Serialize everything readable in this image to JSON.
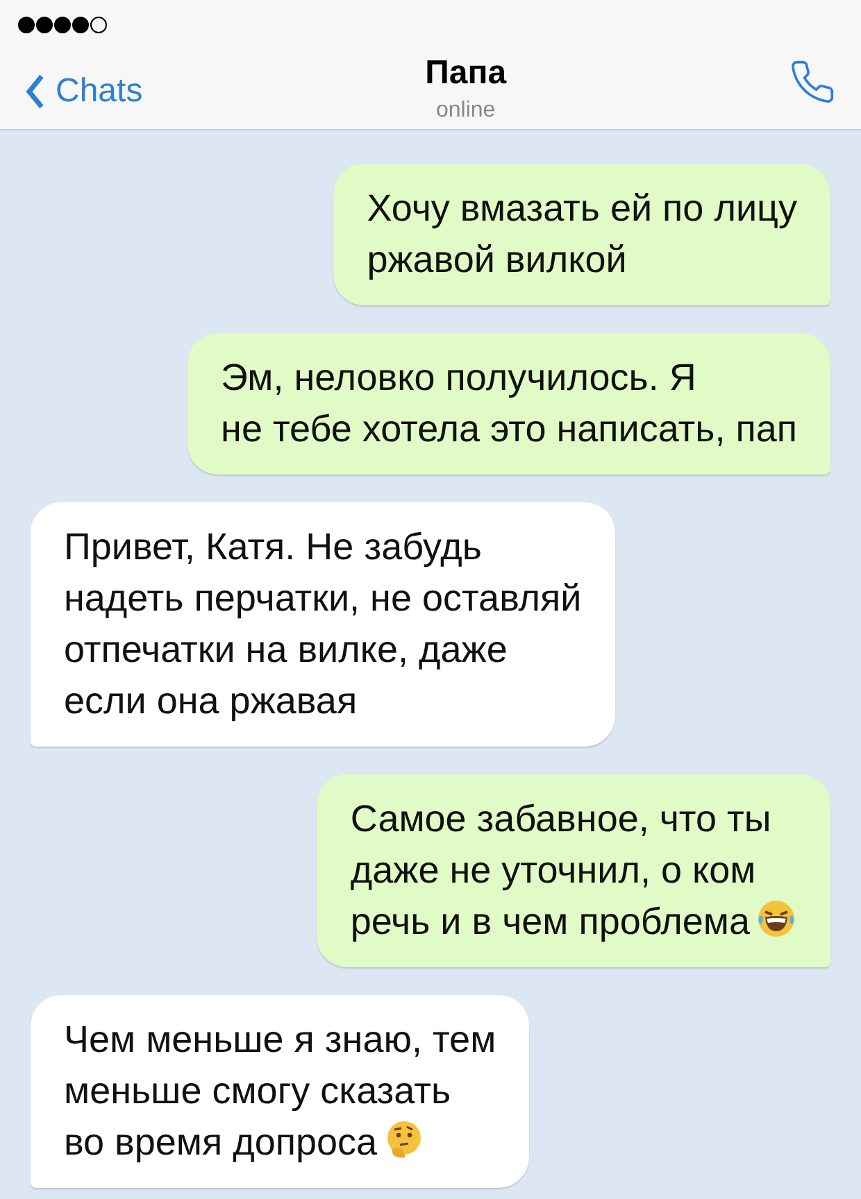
{
  "header": {
    "back_label": "Chats",
    "title": "Папа",
    "status": "online"
  },
  "messages": [
    {
      "kind": "sent",
      "text": "Хочу вмазать ей по лицу\nржавой вилкой"
    },
    {
      "kind": "sent",
      "text": "Эм, неловко получилось. Я\nне тебе хотела это написать, пап"
    },
    {
      "kind": "received",
      "text": "Привет, Катя. Не забудь\nнадеть перчатки, не оставляй\nотпечатки на вилке, даже\nесли она ржавая"
    },
    {
      "kind": "sent",
      "text": "Самое забавное, что ты\nдаже не уточнил, о ком\nречь и в чем проблема",
      "emoji": {
        "kind": "laughing"
      }
    },
    {
      "kind": "received",
      "text": "Чем меньше я знаю, тем\nменьше смогу сказать\nво время допроса",
      "emoji": {
        "kind": "thinking"
      }
    }
  ]
}
